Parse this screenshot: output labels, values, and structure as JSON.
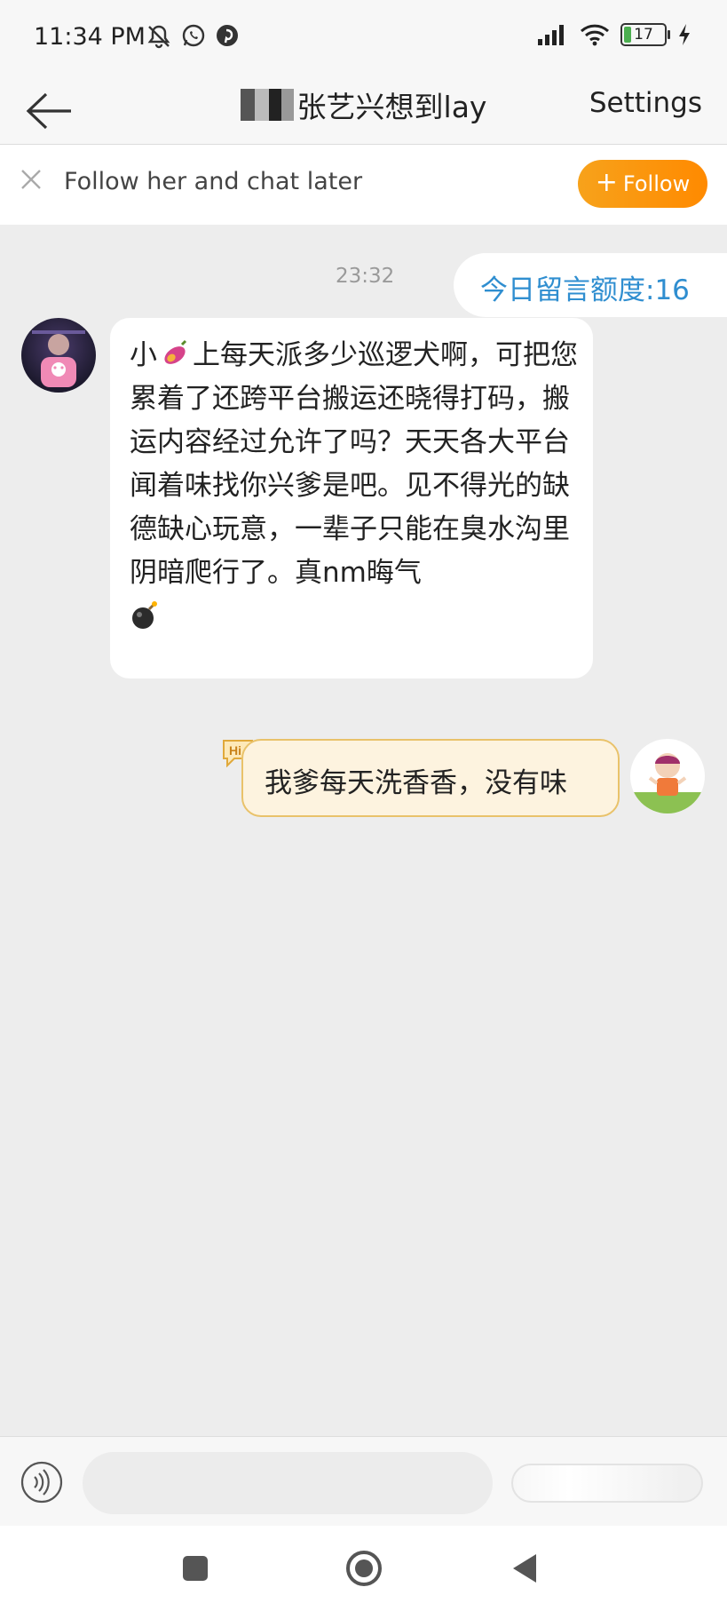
{
  "status_bar": {
    "time": "11:34 PM",
    "battery": "17",
    "icons_left": [
      "mute-bell-icon",
      "whatsapp-icon",
      "pinterest-icon"
    ],
    "icons_right": [
      "signal-icon",
      "wifi-icon",
      "battery-icon",
      "charging-icon"
    ]
  },
  "header": {
    "title": "张艺兴想到lay",
    "settings_label": "Settings"
  },
  "follow_bar": {
    "text": "Follow her and chat later",
    "button_label": "Follow",
    "accent_color": "#ff9412"
  },
  "chat": {
    "timestamp": "23:32",
    "quota_text": "今日留言额度:16",
    "incoming": {
      "text_prefix": "小",
      "text_body": "上每天派多少巡逻犬啊，可把您累着了还跨平台搬运还晓得打码，搬运内容经过允许了吗？天天各大平台闻着味找你兴爹是吧。见不得光的缺德缺心玩意，一辈子只能在臭水沟里阴暗爬行了。真nm晦气"
    },
    "outgoing": {
      "badge": "Hi",
      "text": "我爹每天洗香香，没有味"
    }
  },
  "input": {
    "placeholder": ""
  }
}
